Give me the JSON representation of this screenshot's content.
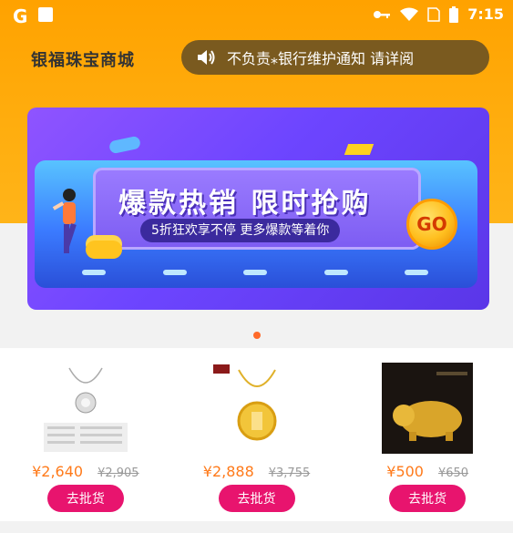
{
  "status_bar": {
    "app_letter": "G",
    "time": "7:15"
  },
  "header": {
    "logo_text": "银福珠宝商城"
  },
  "notice": {
    "text": "不负责⁎银行维护通知 请详阅"
  },
  "banner": {
    "headline": "爆款热销 限时抢购",
    "subline": "5折狂欢享不停 更多爆款等着你",
    "go_label": "GO"
  },
  "products": [
    {
      "icon": "necklace-pendant-image",
      "price": "¥2,640",
      "old_price": "¥2,905",
      "button": "去批货"
    },
    {
      "icon": "gold-fu-pendant-image",
      "price": "¥2,888",
      "old_price": "¥3,755",
      "button": "去批货"
    },
    {
      "icon": "gold-pig-figurine-image",
      "price": "¥500",
      "old_price": "¥650",
      "button": "去批货"
    }
  ],
  "colors": {
    "accent": "#e8146e",
    "price": "#ff7a1a",
    "header": "#ffa200"
  }
}
